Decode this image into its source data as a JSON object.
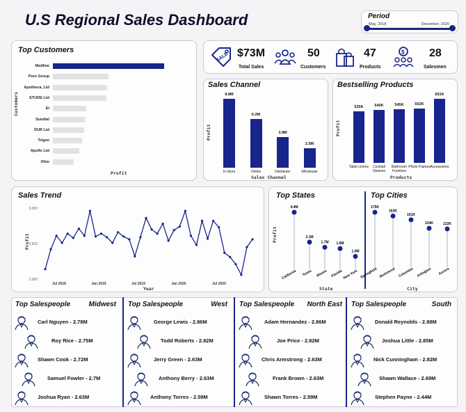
{
  "header": {
    "title": "U.S Regional Sales Dashboard"
  },
  "period": {
    "title": "Period",
    "start": "May, 2018",
    "end": "December, 2020"
  },
  "kpis": [
    {
      "icon": "sale-tag-icon",
      "value": "$73M",
      "label": "Total Sales"
    },
    {
      "icon": "customers-icon",
      "value": "50",
      "label": "Customers"
    },
    {
      "icon": "shopping-bags-icon",
      "value": "47",
      "label": "Products"
    },
    {
      "icon": "salesmen-icon",
      "value": "28",
      "label": "Salesmen"
    }
  ],
  "top_customers": {
    "title": "Top Customers",
    "ylabel": "Customers",
    "xlabel": "Profit",
    "items": [
      {
        "name": "Medline",
        "value": 1.0
      },
      {
        "name": "Pure Group",
        "value": 0.5
      },
      {
        "name": "Apotheca, Ltd",
        "value": 0.49
      },
      {
        "name": "ETUDE Ltd",
        "value": 0.48
      },
      {
        "name": "Ei",
        "value": 0.3
      },
      {
        "name": "Sundial",
        "value": 0.29
      },
      {
        "name": "OUR Ltd",
        "value": 0.28
      },
      {
        "name": "Trigen",
        "value": 0.26
      },
      {
        "name": "Apollo Ltd",
        "value": 0.24
      },
      {
        "name": "Ohio",
        "value": 0.19
      }
    ]
  },
  "sales_channel": {
    "title": "Sales Channel",
    "ylabel": "Profit",
    "xlabel": "Sales Channel",
    "chart_data": {
      "type": "bar",
      "categories": [
        "In-Store",
        "Online",
        "Distributor",
        "Wholesale"
      ],
      "labels": [
        "8.8M",
        "6.2M",
        "3.9M",
        "2.5M"
      ],
      "values": [
        8.8,
        6.2,
        3.9,
        2.5
      ]
    }
  },
  "bestselling": {
    "title": "Bestselling Products",
    "ylabel": "Profit",
    "xlabel": "Products",
    "chart_data": {
      "type": "bar",
      "categories": [
        "Table Linens",
        "Cocktail Glasses",
        "Bathroom Furniture",
        "Photo Frames",
        "Accessories"
      ],
      "labels": [
        "525K",
        "540K",
        "545K",
        "553K",
        "651K"
      ],
      "values": [
        525,
        540,
        545,
        553,
        651
      ]
    }
  },
  "sales_trend": {
    "title": "Sales Trend",
    "ylabel": "Profit",
    "xlabel": "Year",
    "yticks": [
      "3,000",
      "2,500",
      "2,000"
    ],
    "xticks": [
      "Jul 2018",
      "Jan 2019",
      "Jul 2019",
      "Jan 2020",
      "Jul 2020"
    ],
    "chart_data": {
      "type": "line",
      "values": [
        2140,
        2420,
        2610,
        2510,
        2640,
        2580,
        2710,
        2610,
        2960,
        2600,
        2640,
        2590,
        2510,
        2660,
        2600,
        2560,
        2320,
        2590,
        2860,
        2700,
        2640,
        2780,
        2540,
        2690,
        2740,
        2960,
        2610,
        2480,
        2820,
        2570,
        2820,
        2730,
        2370,
        2310,
        2210,
        2060,
        2450,
        2560
      ]
    }
  },
  "top_states": {
    "title": "Top States",
    "ylabel": "Profit",
    "xlabel": "State",
    "chart_data": {
      "type": "scatter",
      "categories": [
        "California",
        "Texas",
        "Illinois",
        "Florida",
        "New York"
      ],
      "labels": [
        "4.4M",
        "2.1M",
        "1.7M",
        "1.6M",
        "1.0M"
      ],
      "values": [
        4.4,
        2.1,
        1.7,
        1.6,
        1.0
      ]
    }
  },
  "top_cities": {
    "title": "Top Cities",
    "xlabel": "City",
    "chart_data": {
      "type": "scatter",
      "categories": [
        "Springfield",
        "Richmond",
        "Columbia",
        "Arlington",
        "Aurora"
      ],
      "labels": [
        "175K",
        "163K",
        "151K",
        "124K",
        "122K"
      ],
      "values": [
        175,
        163,
        151,
        124,
        122
      ]
    }
  },
  "salespeople": [
    {
      "title": "Top Salespeople",
      "region": "Midwest",
      "people": [
        "Carl Nguyen - 2.78M",
        "Roy Rice - 2.75M",
        "Shawn Cook - 2.72M",
        "Samuel Fowler - 2.7M",
        "Joshua Ryan - 2.63M"
      ]
    },
    {
      "title": "Top Salespeople",
      "region": "West",
      "people": [
        "George Lewis - 2.86M",
        "Todd Roberts - 2.82M",
        "Jerry Green - 2.63M",
        "Anthony Berry - 2.63M",
        "Anthony Torres - 2.59M"
      ]
    },
    {
      "title": "Top Salespeople",
      "region": "North East",
      "people": [
        "Adam Hernandez - 2.86M",
        "Joe Price - 2.82M",
        "Chris Armstrong - 2.63M",
        "Frank Brown - 2.63M",
        "Shawn Torres - 2.59M"
      ]
    },
    {
      "title": "Top Salespeople",
      "region": "South",
      "people": [
        "Donald Reynolds - 2.98M",
        "Joshua Little - 2.85M",
        "Nick Cunningham - 2.82M",
        "Shawn Wallace - 2.69M",
        "Stephen Payne - 2.44M"
      ]
    }
  ],
  "colors": {
    "accent": "#17258c",
    "bar_muted": "#e2e2e4",
    "card_border": "#c9cbd3"
  }
}
